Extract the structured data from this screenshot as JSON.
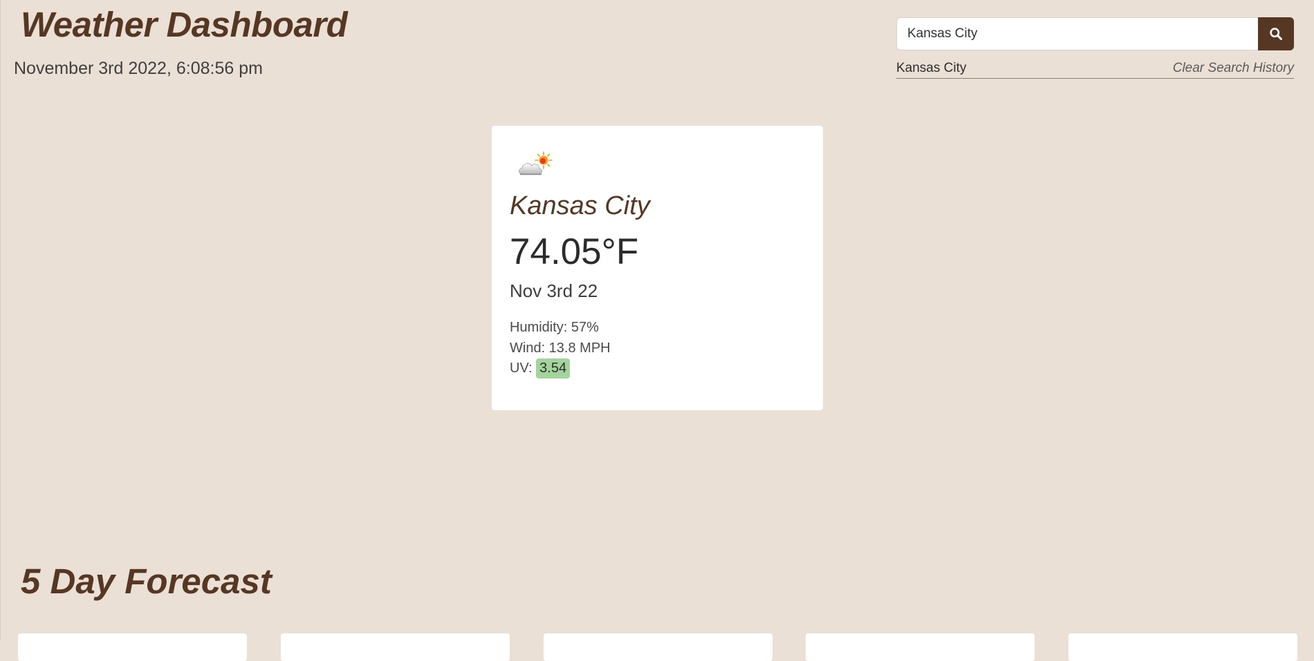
{
  "header": {
    "title": "Weather Dashboard",
    "datetime": "November 3rd 2022, 6:08:56 pm"
  },
  "search": {
    "value": "Kansas City",
    "button_icon": "search-icon",
    "history": [
      "Kansas City"
    ],
    "clear_label": "Clear Search History"
  },
  "current": {
    "icon": "partly-cloudy-icon",
    "city": "Kansas City",
    "temperature": "74.05°F",
    "date": "Nov 3rd 22",
    "humidity_label": "Humidity: 57%",
    "wind_label": "Wind: 13.8 MPH",
    "uv_prefix": "UV:",
    "uv_value": "3.54",
    "uv_color": "#a3d49c"
  },
  "forecast": {
    "title": "5 Day Forecast",
    "card_count": 5
  },
  "colors": {
    "background": "#eae0d6",
    "accent": "#563723",
    "card": "#ffffff"
  }
}
